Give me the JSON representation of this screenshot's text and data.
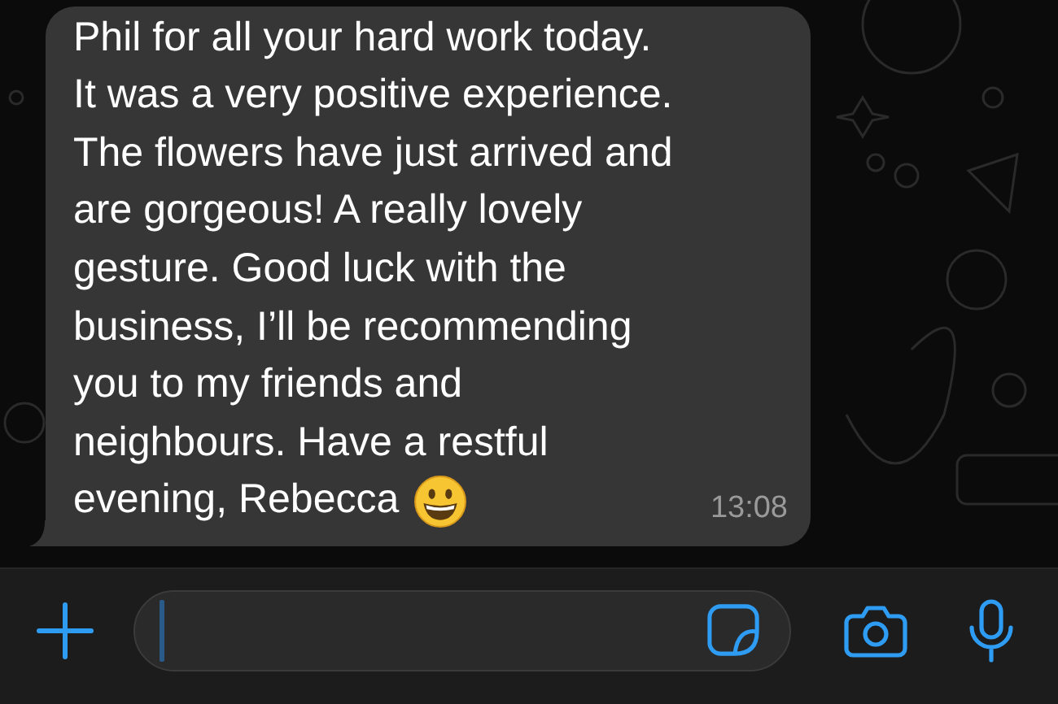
{
  "chat": {
    "messages": [
      {
        "kind": "incoming",
        "lines": [
          "Phil for all your hard work today.",
          "It was a very positive experience.",
          "The flowers have just arrived and",
          "are gorgeous! A really lovely",
          "gesture. Good luck with the",
          "business, I’ll be recommending",
          "you to my friends and",
          "neighbours. Have a restful",
          "evening, Rebecca"
        ],
        "time": "13:08"
      }
    ]
  }
}
